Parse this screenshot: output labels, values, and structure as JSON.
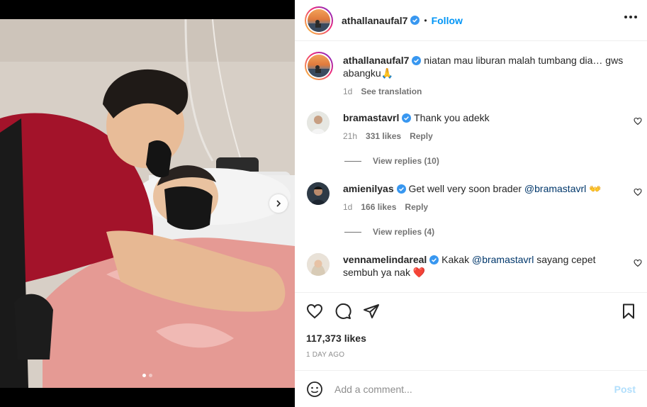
{
  "post": {
    "username": "athallanaufal7",
    "follow_label": "Follow",
    "separator": "•"
  },
  "caption": {
    "username": "athallanaufal7",
    "text": "niatan mau liburan malah tumbang dia… gws abangku🙏",
    "age": "1d",
    "see_translation": "See translation"
  },
  "comments": [
    {
      "username": "bramastavrl",
      "text": "Thank you adekk",
      "age": "21h",
      "likes": "331 likes",
      "reply": "Reply",
      "view_replies": "View replies (10)"
    },
    {
      "username": "amienilyas",
      "text_before": "Get well very soon brader ",
      "mention": "@bramastavrl",
      "text_after": " 👐",
      "age": "1d",
      "likes": "166 likes",
      "reply": "Reply",
      "view_replies": "View replies (4)"
    },
    {
      "username": "vennamelindareal",
      "text_before": "Kakak ",
      "mention": "@bramastavrl",
      "text_after": " sayang cepet sembuh ya nak ❤️"
    }
  ],
  "stats": {
    "likes": "117,373 likes",
    "date": "1 DAY AGO"
  },
  "composer": {
    "placeholder": "Add a comment...",
    "post_label": "Post"
  },
  "carousel": {
    "slide_count": 2,
    "active_index": 0
  },
  "colors": {
    "accent": "#0095f6",
    "verified": "#3897f0",
    "post_disabled": "#b2dffc"
  }
}
